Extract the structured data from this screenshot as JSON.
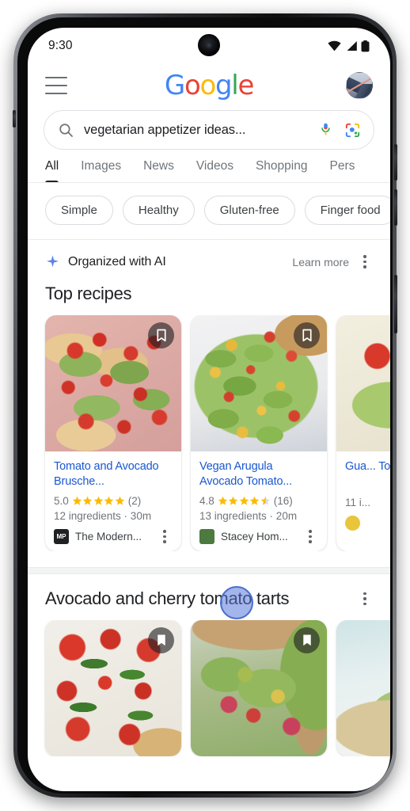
{
  "status_bar": {
    "time": "9:30",
    "icons": [
      "wifi-icon",
      "cell-signal-icon",
      "battery-icon"
    ]
  },
  "app_bar": {
    "menu_icon": "hamburger-menu-icon",
    "logo": {
      "text": "Google",
      "letters": [
        "G",
        "o",
        "o",
        "g",
        "l",
        "e"
      ],
      "colors": [
        "#4285F4",
        "#EA4335",
        "#FBBC05",
        "#4285F4",
        "#34A853",
        "#EA4335"
      ]
    },
    "avatar": "user-avatar"
  },
  "search": {
    "query": "vegetarian appetizer ideas...",
    "search_icon": "search-icon",
    "voice_icon": "microphone-icon",
    "lens_icon": "google-lens-icon"
  },
  "tabs": [
    {
      "label": "All",
      "active": true
    },
    {
      "label": "Images",
      "active": false
    },
    {
      "label": "News",
      "active": false
    },
    {
      "label": "Videos",
      "active": false
    },
    {
      "label": "Shopping",
      "active": false
    },
    {
      "label": "Pers",
      "active": false
    }
  ],
  "chips": [
    "Simple",
    "Healthy",
    "Gluten-free",
    "Finger food"
  ],
  "ai_strip": {
    "icon": "sparkle-icon",
    "icon_color": "#5E82E8",
    "label": "Organized with AI",
    "learn_more": "Learn more",
    "menu_icon": "three-dot-menu-icon"
  },
  "sections": [
    {
      "title": "Top recipes",
      "cards": [
        {
          "title": "Tomato and Avocado Brusche...",
          "rating": "5.0",
          "stars": 5,
          "review_count": "(2)",
          "meta": "12 ingredients · 30m",
          "source": "The Modern...",
          "favicon_text": "MP",
          "favicon_bg": "#202124",
          "photo": "photo-bruschetta",
          "bookmark_icon": "bookmark-icon"
        },
        {
          "title": "Vegan Arugula Avocado Tomato...",
          "rating": "4.8",
          "stars": 4.5,
          "review_count": "(16)",
          "meta": "13 ingredients · 20m",
          "source": "Stacey Hom...",
          "favicon_text": "",
          "favicon_bg": "#4c7a3f",
          "photo": "photo-salad",
          "bookmark_icon": "bookmark-icon"
        },
        {
          "title": "Gua... Tom...",
          "rating": "",
          "stars": 0,
          "review_count": "",
          "meta": "11 i...",
          "source": "",
          "favicon_text": "",
          "favicon_bg": "#e8c53a",
          "photo": "photo-guac",
          "bookmark_icon": "bookmark-icon"
        }
      ]
    },
    {
      "title": "Avocado and cherry tomato tarts",
      "menu_icon": "three-dot-menu-icon",
      "cards": [
        {
          "photo": "photo-tart-tomato",
          "bookmark_icon": "bookmark-icon"
        },
        {
          "photo": "photo-tart-avocado",
          "bookmark_icon": "bookmark-icon"
        },
        {
          "photo": "photo-tart-third",
          "bookmark_icon": "bookmark-icon"
        }
      ]
    }
  ],
  "touch_indicator": "touch-point-indicator"
}
